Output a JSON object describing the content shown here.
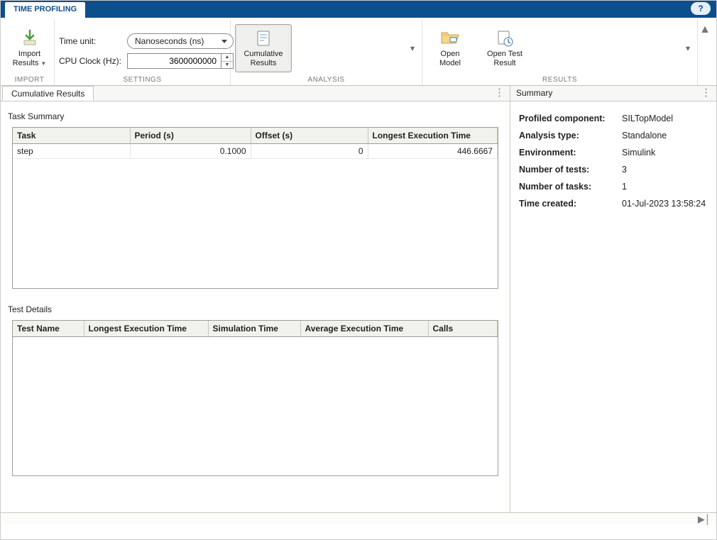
{
  "top_tab": "TIME PROFILING",
  "ribbon": {
    "import": {
      "label": "IMPORT",
      "button_line1": "Import",
      "button_line2": "Results"
    },
    "settings": {
      "label": "SETTINGS",
      "time_unit_label": "Time unit:",
      "time_unit_value": "Nanoseconds (ns)",
      "cpu_clock_label": "CPU Clock (Hz):",
      "cpu_clock_value": "3600000000"
    },
    "analysis": {
      "label": "ANALYSIS",
      "cumulative_line1": "Cumulative",
      "cumulative_line2": "Results"
    },
    "results": {
      "label": "RESULTS",
      "open_model_line1": "Open",
      "open_model_line2": "Model",
      "open_test_line1": "Open Test",
      "open_test_line2": "Result"
    }
  },
  "left_panel_tab": "Cumulative Results",
  "task_summary": {
    "title": "Task Summary",
    "headers": {
      "task": "Task",
      "period": "Period (s)",
      "offset": "Offset (s)",
      "longest": "Longest Execution Time"
    },
    "rows": [
      {
        "task": "step",
        "period": "0.1000",
        "offset": "0",
        "longest": "446.6667"
      }
    ]
  },
  "test_details": {
    "title": "Test Details",
    "headers": {
      "name": "Test Name",
      "longest": "Longest Execution Time",
      "sim": "Simulation Time",
      "avg": "Average Execution Time",
      "calls": "Calls"
    }
  },
  "right_panel_tab": "Summary",
  "summary": {
    "profiled_component_k": "Profiled component:",
    "profiled_component_v": "SILTopModel",
    "analysis_type_k": "Analysis type:",
    "analysis_type_v": "Standalone",
    "environment_k": "Environment:",
    "environment_v": "Simulink",
    "num_tests_k": "Number of tests:",
    "num_tests_v": "3",
    "num_tasks_k": "Number of tasks:",
    "num_tasks_v": "1",
    "time_created_k": "Time created:",
    "time_created_v": "01-Jul-2023 13:58:24"
  }
}
